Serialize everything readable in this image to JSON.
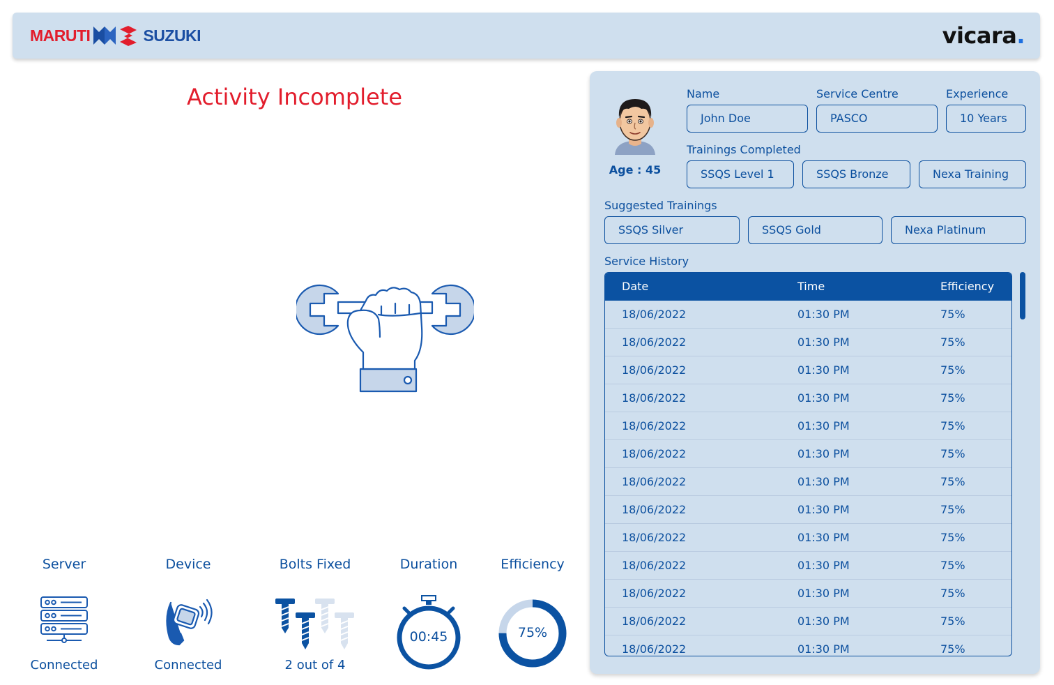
{
  "header": {
    "brand_left": "MARUTI",
    "brand_right": "SUZUKI",
    "brand_vicara": "vicara",
    "brand_vicara_dot": ".",
    "colors": {
      "maruti_red": "#e21d2c",
      "suzuki_blue": "#1a4ea2",
      "accent_blue": "#0b4f9e",
      "panel_bg": "#cfdfee"
    }
  },
  "main": {
    "title": "Activity Incomplete",
    "hero_icon": "hand-holding-wrench-icon"
  },
  "stats": {
    "server": {
      "label": "Server",
      "status": "Connected",
      "icon": "server-icon"
    },
    "device": {
      "label": "Device",
      "status": "Connected",
      "icon": "smartwatch-icon"
    },
    "bolts": {
      "label": "Bolts Fixed",
      "status": "2 out of 4",
      "fixed": 2,
      "total": 4,
      "icon": "bolts-icon"
    },
    "duration": {
      "label": "Duration",
      "value": "00:45",
      "icon": "stopwatch-icon"
    },
    "efficiency": {
      "label": "Efficiency",
      "value": "75%",
      "percent": 75,
      "icon": "donut-gauge"
    }
  },
  "profile": {
    "age": "Age : 45",
    "name_label": "Name",
    "name": "John Doe",
    "service_centre_label": "Service Centre",
    "service_centre": "PASCO",
    "experience_label": "Experience",
    "experience": "10 Years",
    "trainings_completed_label": "Trainings Completed",
    "trainings_completed": [
      "SSQS Level 1",
      "SSQS Bronze",
      "Nexa Training"
    ],
    "suggested_trainings_label": "Suggested Trainings",
    "suggested_trainings": [
      "SSQS Silver",
      "SSQS Gold",
      "Nexa Platinum"
    ]
  },
  "history": {
    "label": "Service History",
    "columns": [
      "Date",
      "Time",
      "Efficiency"
    ],
    "rows": [
      [
        "18/06/2022",
        "01:30 PM",
        "75%"
      ],
      [
        "18/06/2022",
        "01:30 PM",
        "75%"
      ],
      [
        "18/06/2022",
        "01:30 PM",
        "75%"
      ],
      [
        "18/06/2022",
        "01:30 PM",
        "75%"
      ],
      [
        "18/06/2022",
        "01:30 PM",
        "75%"
      ],
      [
        "18/06/2022",
        "01:30 PM",
        "75%"
      ],
      [
        "18/06/2022",
        "01:30 PM",
        "75%"
      ],
      [
        "18/06/2022",
        "01:30 PM",
        "75%"
      ],
      [
        "18/06/2022",
        "01:30 PM",
        "75%"
      ],
      [
        "18/06/2022",
        "01:30 PM",
        "75%"
      ],
      [
        "18/06/2022",
        "01:30 PM",
        "75%"
      ],
      [
        "18/06/2022",
        "01:30 PM",
        "75%"
      ],
      [
        "18/06/2022",
        "01:30 PM",
        "75%"
      ]
    ]
  }
}
